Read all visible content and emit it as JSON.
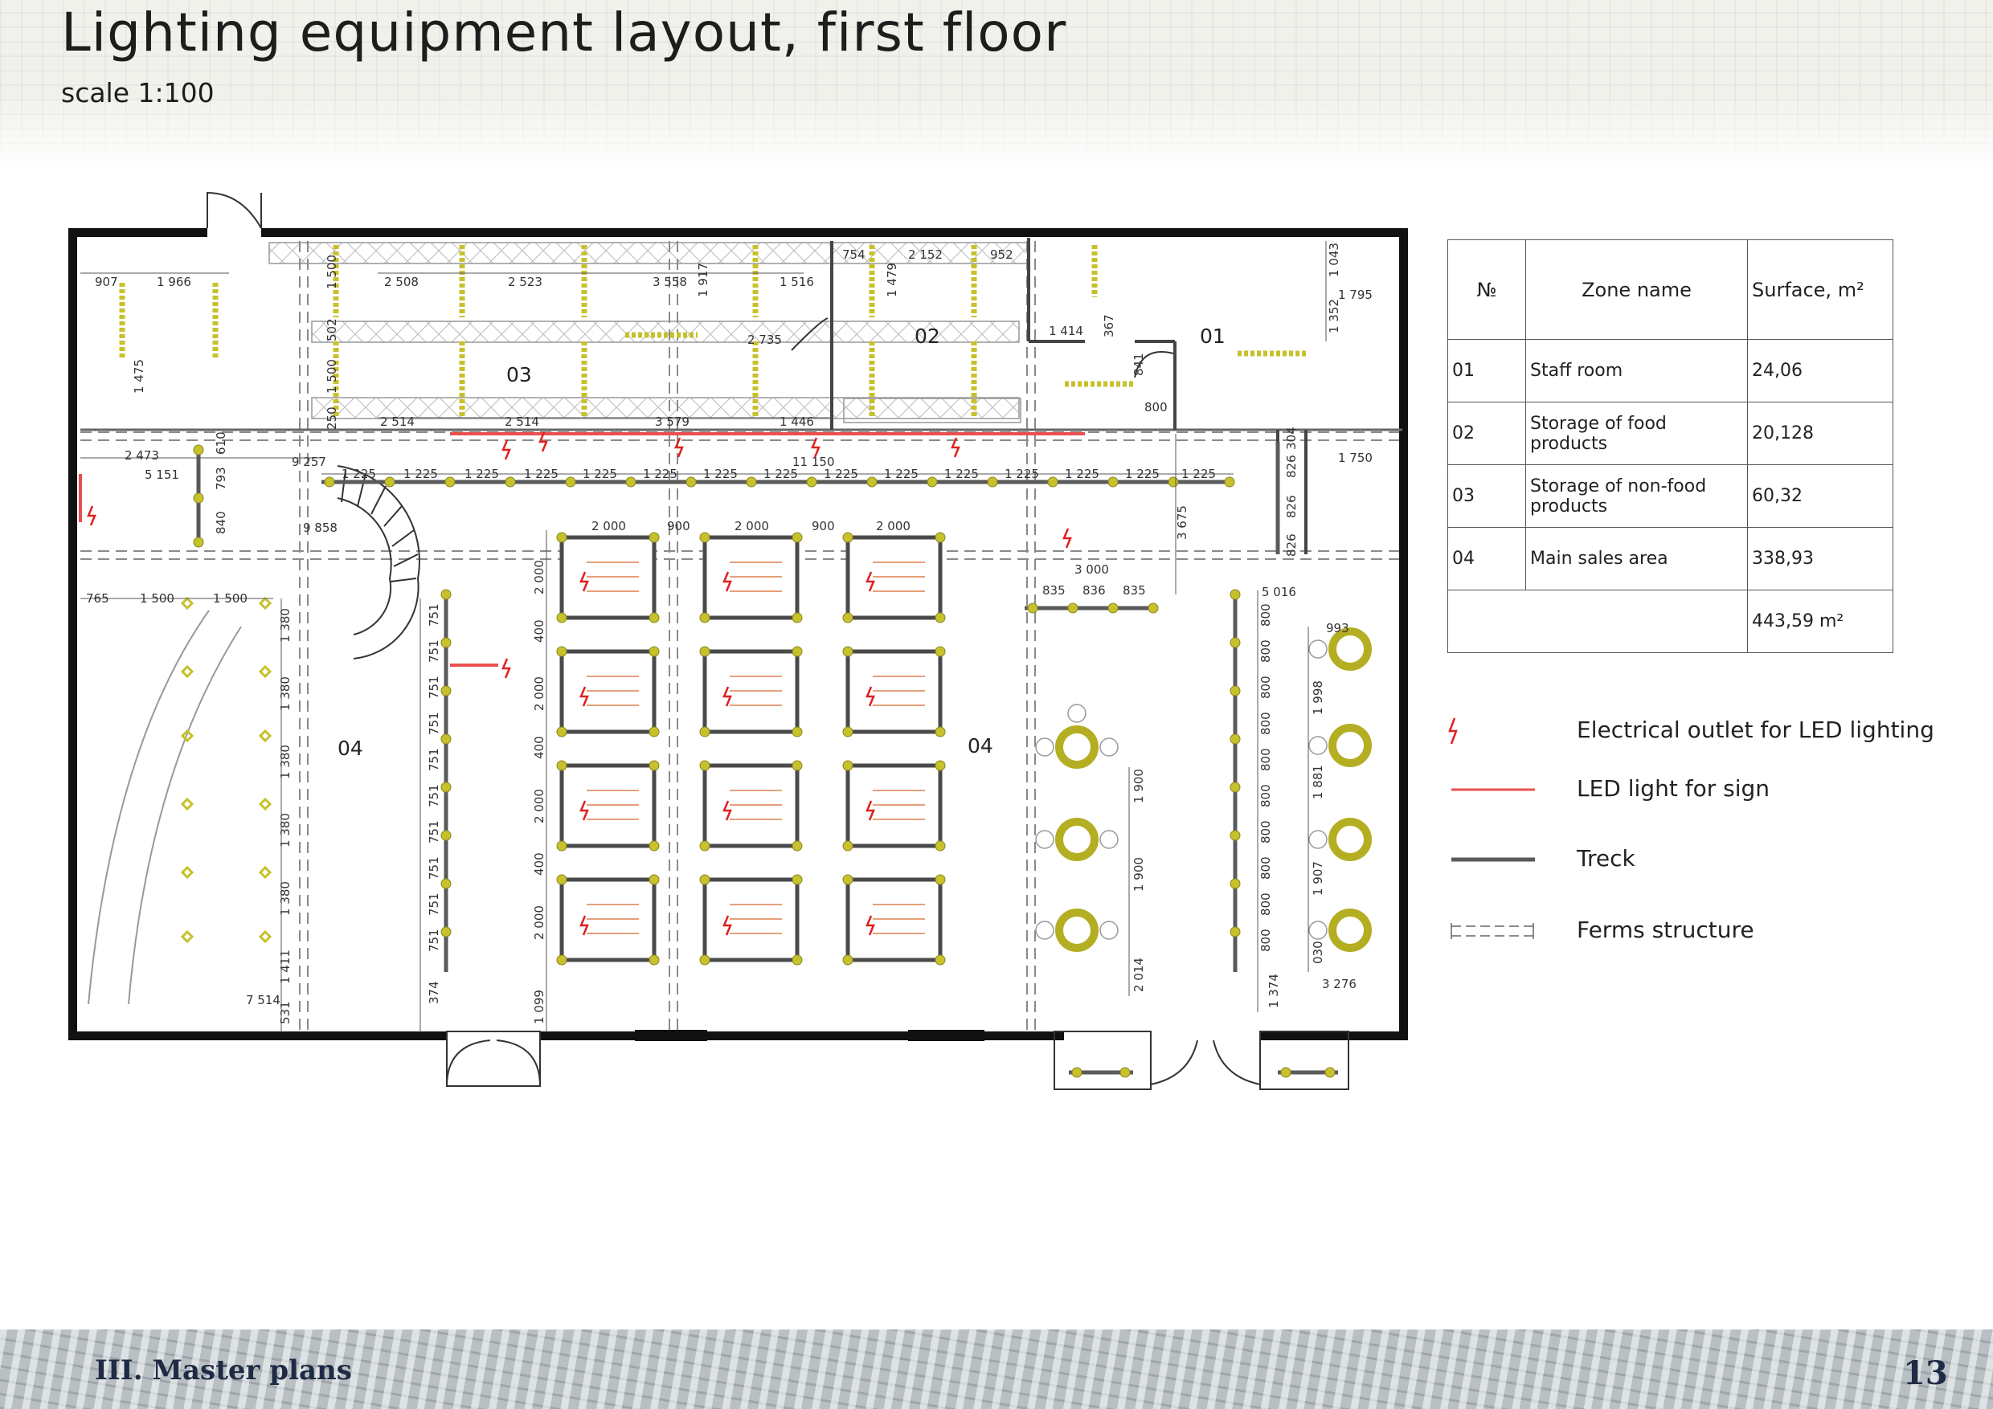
{
  "header": {
    "title": "Lighting equipment layout, first floor",
    "subtitle": "scale 1:100"
  },
  "colors": {
    "wall": "#111111",
    "track": "#5a5a5a",
    "lamp": "#c7c12c",
    "outlet": "#e02020",
    "led_sign": "#e85050",
    "truss": "#888888"
  },
  "plan": {
    "zones": {
      "z01": "01",
      "z02": "02",
      "z03": "03",
      "z04_left": "04",
      "z04_main": "04"
    },
    "dims": {
      "d907": "907",
      "d1966": "1 966",
      "d1475": "1 475",
      "d2508": "2 508",
      "d2523": "2 523",
      "d3558": "3 558",
      "d1516": "1 516",
      "d2735": "2 735",
      "d1500a": "1 500",
      "d502": "502",
      "d1500b": "1 500",
      "d250": "250",
      "d2514a": "2 514",
      "d2514b": "2 514",
      "d3579": "3 579",
      "d1446": "1 446",
      "d754": "754",
      "d2152": "2 152",
      "d952": "952",
      "d1479": "1 479",
      "d1917": "1 917",
      "d1414": "1 414",
      "d367": "367",
      "d841": "841",
      "d800a": "800",
      "d1043": "1 043",
      "d1795": "1 795",
      "d1352": "1 352",
      "d2473": "2 473",
      "d610": "610",
      "d5151": "5 151",
      "d793": "793",
      "d840": "840",
      "d9257": "9 257",
      "d11150": "11 150",
      "d9858": "9 858",
      "d1225": "1 225",
      "d1750": "1 750",
      "d304": "304",
      "d826": "826",
      "d3675": "3 675",
      "d3000": "3 000",
      "d835": "835",
      "d836": "836",
      "d5016": "5 016",
      "d993": "993",
      "d765": "765",
      "d1500c": "1 500",
      "d1500d": "1 500",
      "d1380": "1 380",
      "d1411": "1 411",
      "d7514": "7 514",
      "d531": "531",
      "d751": "751",
      "d374": "374",
      "d1374": "1 374",
      "d2000": "2 000",
      "d400": "400",
      "d900": "900",
      "d1099": "1 099",
      "d1900": "1 900",
      "d2014": "2 014",
      "d1998": "1 998",
      "d1881": "1 881",
      "d1907": "1 907",
      "d030": "030",
      "d3276": "3 276",
      "d800": "800"
    }
  },
  "zone_table": {
    "headers": {
      "num": "№",
      "name": "Zone name",
      "surface": "Surface, m²"
    },
    "rows": [
      {
        "num": "01",
        "name": "Staff room",
        "surface": "24,06"
      },
      {
        "num": "02",
        "name": "Storage of food products",
        "surface": "20,128"
      },
      {
        "num": "03",
        "name": "Storage of non-food products",
        "surface": "60,32"
      },
      {
        "num": "04",
        "name": "Main sales area",
        "surface": "338,93"
      }
    ],
    "total": "443,59 m²"
  },
  "legend": [
    {
      "icon": "lightning-outlet-icon",
      "label": "Electrical outlet for LED lighting"
    },
    {
      "icon": "red-line-icon",
      "label": "LED light for sign"
    },
    {
      "icon": "gray-line-icon",
      "label": "Treck"
    },
    {
      "icon": "dashed-truss-icon",
      "label": "Ferms structure"
    }
  ],
  "footer": {
    "section": "III. Master plans",
    "page_number": "13"
  }
}
